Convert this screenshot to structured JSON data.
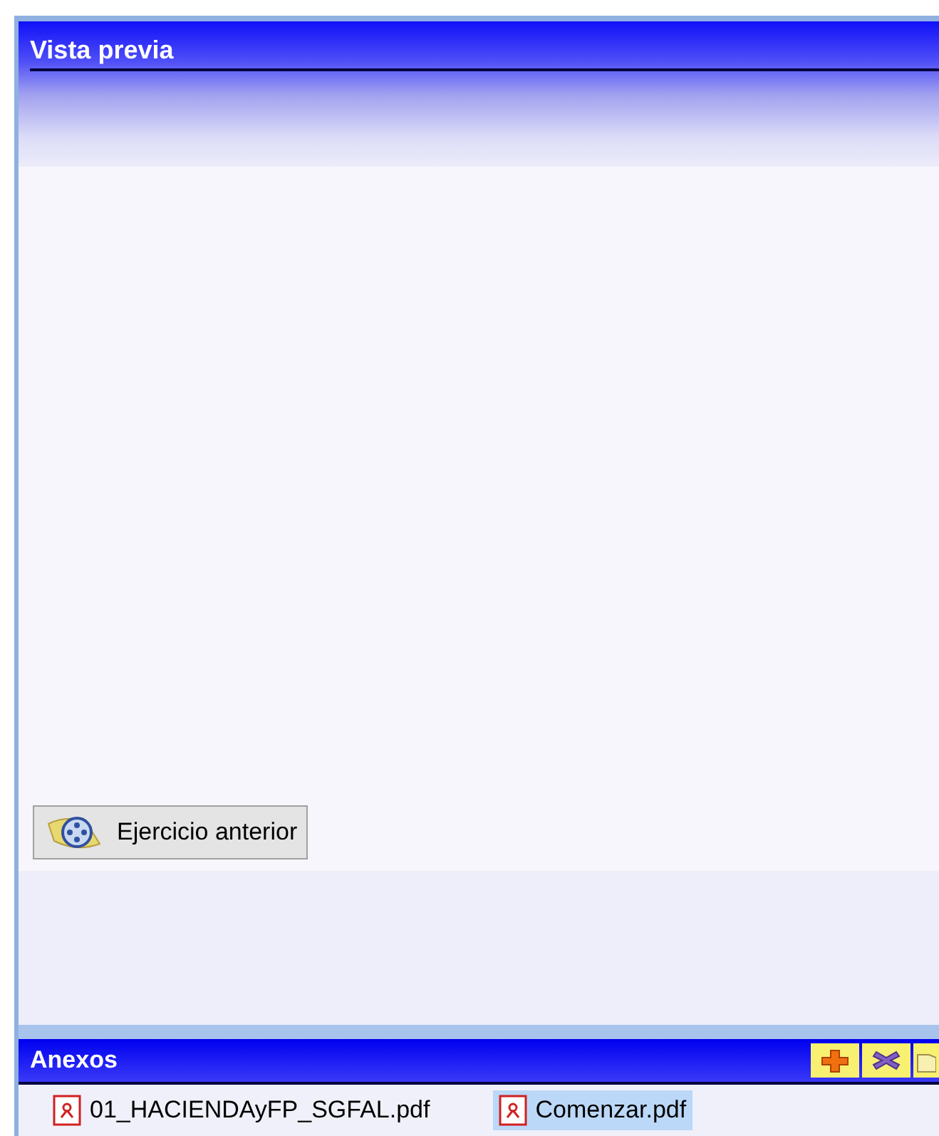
{
  "preview": {
    "title": "Vista previa",
    "button": "Ejercicio anterior"
  },
  "attachments": {
    "title": "Anexos",
    "files": [
      {
        "name": "01_HACIENDAyFP_SGFAL.pdf",
        "selected": false
      },
      {
        "name": "Comenzar.pdf",
        "selected": true
      }
    ]
  }
}
